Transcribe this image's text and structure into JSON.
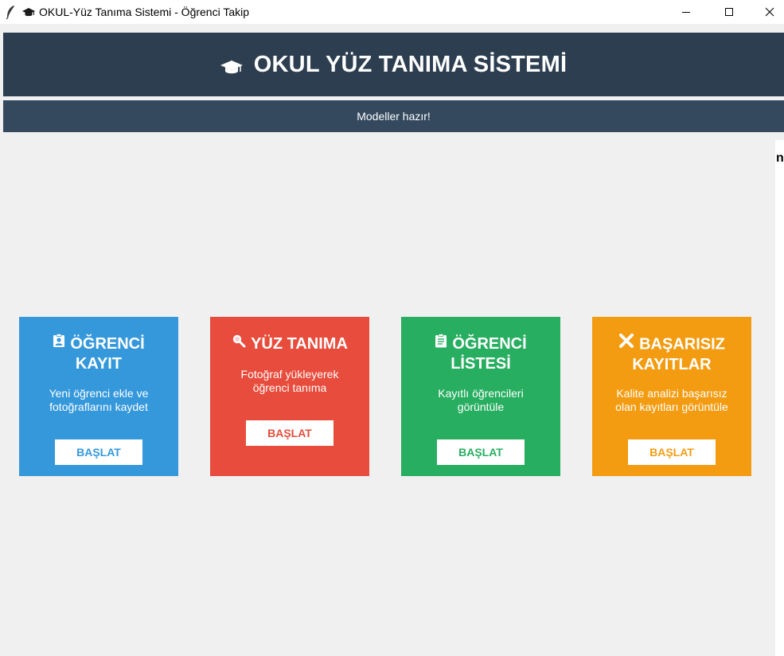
{
  "window": {
    "title": "OKUL-Yüz Tanıma Sistemi - Öğrenci Takip",
    "buttons": [
      "minimize",
      "maximize",
      "close"
    ]
  },
  "header": {
    "title": "OKUL YÜZ TANIMA SİSTEMİ",
    "icon": "graduation-cap-icon",
    "bg": "#2c3e50"
  },
  "status": {
    "text": "Modeller hazır!",
    "bg": "#34495e"
  },
  "right_strip": {
    "text": "n"
  },
  "cards": [
    {
      "icon": "student-id-icon",
      "title_line1": "ÖĞRENCİ",
      "title_line2": "KAYIT",
      "desc_line1": "Yeni öğrenci ekle ve",
      "desc_line2": "fotoğraflarını kaydet",
      "button": "BAŞLAT",
      "color": "#3498db"
    },
    {
      "icon": "magnifier-icon",
      "title_line1": "YÜZ TANIMA",
      "title_line2": "",
      "desc_line1": "Fotoğraf yükleyerek",
      "desc_line2": "öğrenci tanıma",
      "button": "BAŞLAT",
      "color": "#e74c3c"
    },
    {
      "icon": "clipboard-icon",
      "title_line1": "ÖĞRENCİ",
      "title_line2": "LİSTESİ",
      "desc_line1": "Kayıtlı öğrencileri",
      "desc_line2": "görüntüle",
      "button": "BAŞLAT",
      "color": "#27ae60"
    },
    {
      "icon": "cross-mark-icon",
      "title_line1": "BAŞARISIZ",
      "title_line2": "KAYITLAR",
      "desc_line1": "Kalite analizi başarısız",
      "desc_line2": "olan kayıtları görüntüle",
      "button": "BAŞLAT",
      "color": "#f39c12"
    }
  ]
}
